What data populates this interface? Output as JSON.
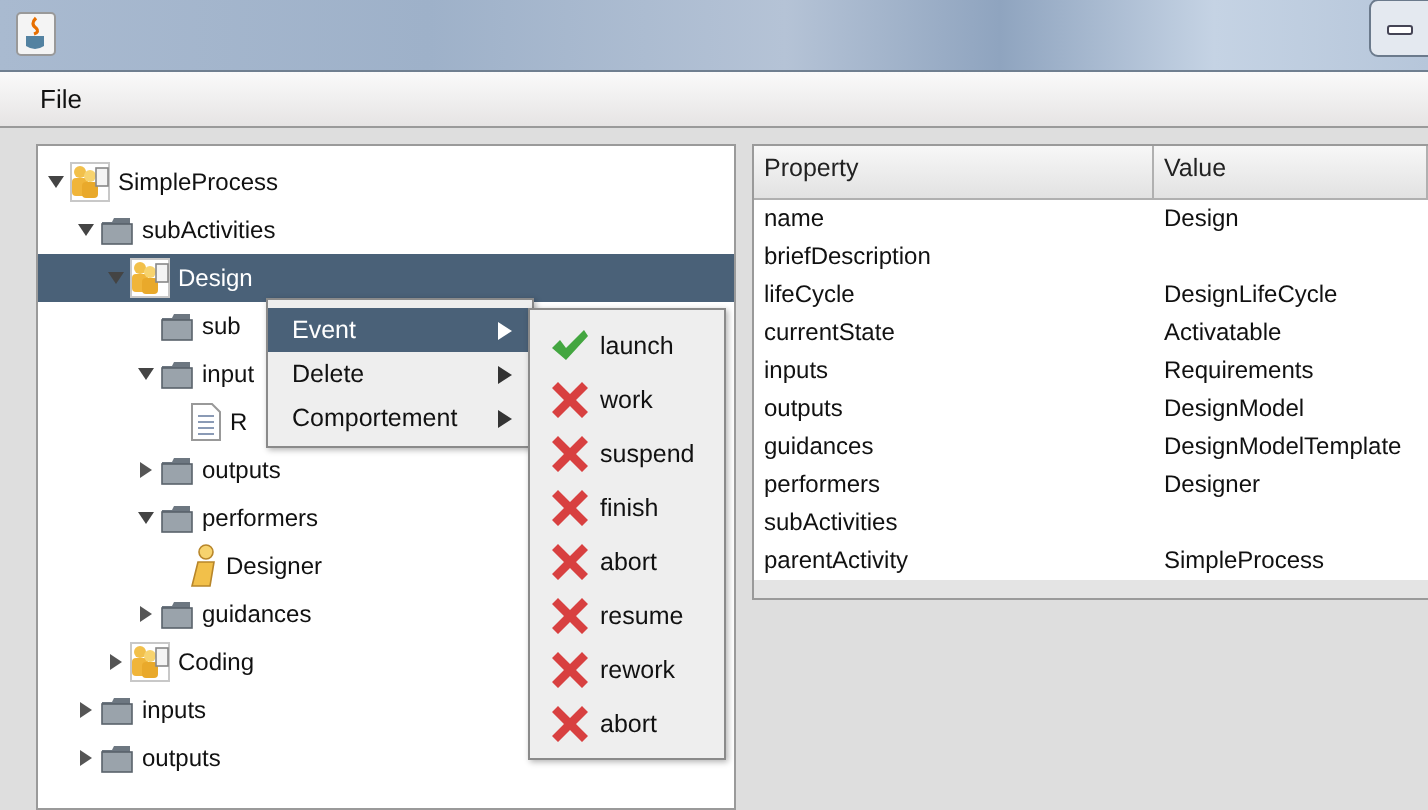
{
  "menu_bar": {
    "items": [
      {
        "label": "File"
      }
    ]
  },
  "tree": {
    "nodes": [
      {
        "label": "SimpleProcess",
        "kind": "process",
        "expanded": true,
        "selected": false,
        "children": [
          {
            "label": "subActivities",
            "kind": "folder",
            "expanded": true,
            "selected": false,
            "children": [
              {
                "label": "Design",
                "kind": "process",
                "expanded": true,
                "selected": true,
                "children": [
                  {
                    "label": "sub",
                    "kind": "folder",
                    "selected": false
                  },
                  {
                    "label": "input",
                    "kind": "folder",
                    "expanded": true,
                    "selected": false,
                    "children": [
                      {
                        "label": "R",
                        "kind": "document",
                        "selected": false
                      }
                    ]
                  },
                  {
                    "label": "outputs",
                    "kind": "folder",
                    "expanded": false,
                    "selected": false
                  },
                  {
                    "label": "performers",
                    "kind": "folder",
                    "expanded": true,
                    "selected": false,
                    "children": [
                      {
                        "label": "Designer",
                        "kind": "person",
                        "selected": false
                      }
                    ]
                  },
                  {
                    "label": "guidances",
                    "kind": "folder",
                    "expanded": false,
                    "selected": false
                  }
                ]
              },
              {
                "label": "Coding",
                "kind": "process",
                "expanded": false,
                "selected": false
              }
            ]
          },
          {
            "label": "inputs",
            "kind": "folder",
            "expanded": false,
            "selected": false
          },
          {
            "label": "outputs",
            "kind": "folder",
            "expanded": false,
            "selected": false
          }
        ]
      }
    ]
  },
  "context_menu": {
    "items": [
      {
        "label": "Event",
        "selected": true
      },
      {
        "label": "Delete",
        "selected": false
      },
      {
        "label": "Comportement",
        "selected": false
      }
    ]
  },
  "submenu": {
    "items": [
      {
        "label": "launch",
        "kind": "check"
      },
      {
        "label": "work",
        "kind": "cross"
      },
      {
        "label": "suspend",
        "kind": "cross"
      },
      {
        "label": "finish",
        "kind": "cross"
      },
      {
        "label": "abort",
        "kind": "cross"
      },
      {
        "label": "resume",
        "kind": "cross"
      },
      {
        "label": "rework",
        "kind": "cross"
      },
      {
        "label": "abort",
        "kind": "cross"
      }
    ]
  },
  "table": {
    "columns": [
      "Property",
      "Value"
    ],
    "rows": [
      [
        "name",
        "Design"
      ],
      [
        "briefDescription",
        ""
      ],
      [
        "lifeCycle",
        "DesignLifeCycle"
      ],
      [
        "currentState",
        "Activatable"
      ],
      [
        "inputs",
        "Requirements"
      ],
      [
        "outputs",
        "DesignModel"
      ],
      [
        "guidances",
        "DesignModelTemplate"
      ],
      [
        "performers",
        "Designer"
      ],
      [
        "subActivities",
        ""
      ],
      [
        "parentActivity",
        "SimpleProcess"
      ]
    ]
  }
}
